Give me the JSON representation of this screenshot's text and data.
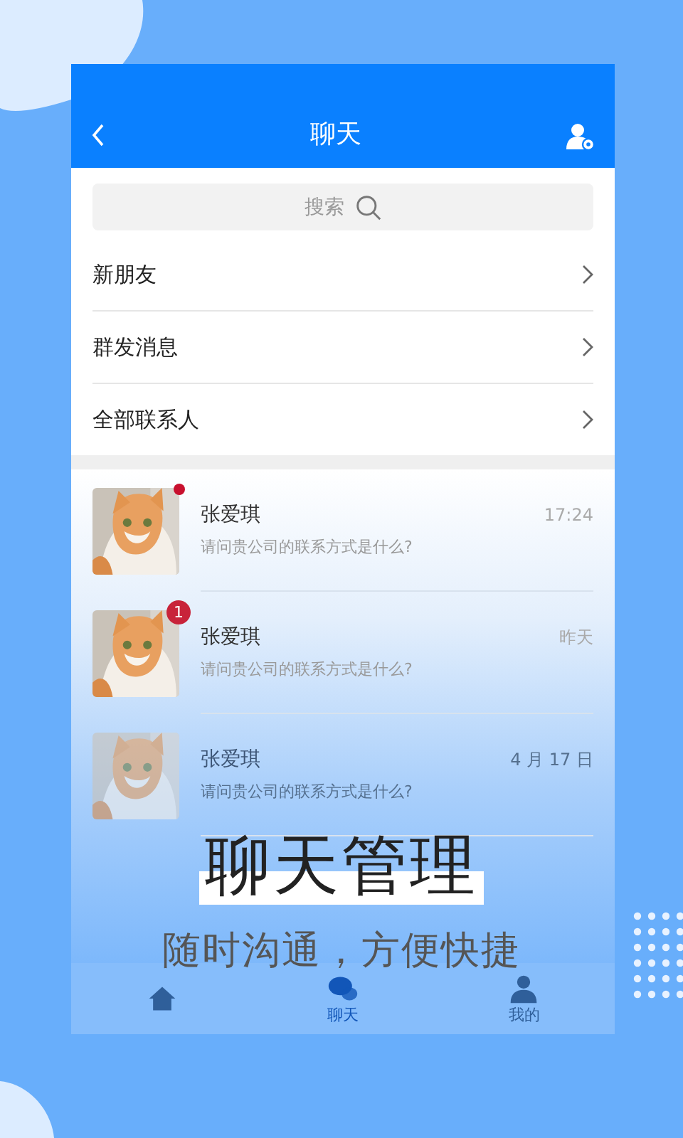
{
  "header": {
    "title": "聊天"
  },
  "search": {
    "placeholder": "搜索"
  },
  "menu": [
    {
      "label": "新朋友"
    },
    {
      "label": "群发消息"
    },
    {
      "label": "全部联系人"
    }
  ],
  "chats": [
    {
      "name": "张爱琪",
      "message": "请问贵公司的联系方式是什么?",
      "time": "17:24",
      "badge": {
        "kind": "dot"
      }
    },
    {
      "name": "张爱琪",
      "message": "请问贵公司的联系方式是什么?",
      "time": "昨天",
      "badge": {
        "kind": "count",
        "text": "1"
      }
    },
    {
      "name": "张爱琪",
      "message": "请问贵公司的联系方式是什么?",
      "time": "4 月 17 日"
    }
  ],
  "tab_bar": [
    {
      "kind": "home",
      "selected": false
    },
    {
      "kind": "chat",
      "label": "聊天",
      "selected": true
    },
    {
      "kind": "me",
      "label": "我的",
      "selected": false
    }
  ],
  "tagline": {
    "title": "聊天管理",
    "subtitle": "随时沟通，方便快捷"
  }
}
